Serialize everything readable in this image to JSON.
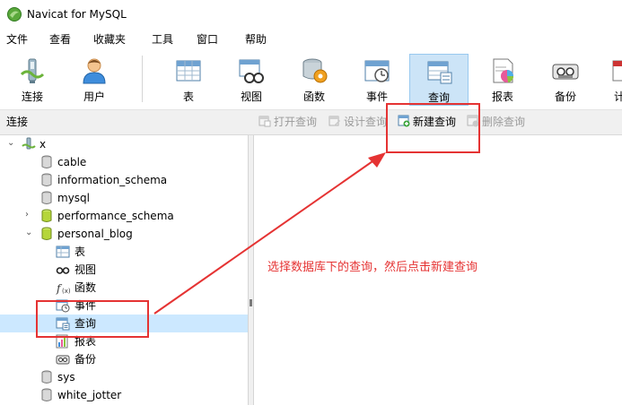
{
  "window": {
    "title": "Navicat for MySQL"
  },
  "menu": [
    "文件",
    "查看",
    "收藏夹",
    "工具",
    "窗口",
    "帮助"
  ],
  "toolbar": [
    {
      "label": "连接",
      "icon": "connection-icon"
    },
    {
      "label": "用户",
      "icon": "user-icon"
    },
    {
      "label": "表",
      "icon": "table-icon"
    },
    {
      "label": "视图",
      "icon": "view-icon"
    },
    {
      "label": "函数",
      "icon": "function-icon"
    },
    {
      "label": "事件",
      "icon": "event-icon"
    },
    {
      "label": "查询",
      "icon": "query-icon",
      "active": true
    },
    {
      "label": "报表",
      "icon": "report-icon"
    },
    {
      "label": "备份",
      "icon": "backup-icon"
    },
    {
      "label": "计",
      "icon": "schedule-icon"
    }
  ],
  "subheader": {
    "connection_label": "连接",
    "actions": [
      {
        "label": "打开查询",
        "enabled": false
      },
      {
        "label": "设计查询",
        "enabled": false
      },
      {
        "label": "新建查询",
        "enabled": true
      },
      {
        "label": "删除查询",
        "enabled": false
      }
    ]
  },
  "tree": [
    {
      "label": "x",
      "type": "connection",
      "expanded": true
    },
    {
      "label": "cable",
      "type": "database"
    },
    {
      "label": "information_schema",
      "type": "database"
    },
    {
      "label": "mysql",
      "type": "database"
    },
    {
      "label": "performance_schema",
      "type": "database-open",
      "collapsed": true
    },
    {
      "label": "personal_blog",
      "type": "database-open",
      "expanded": true
    },
    {
      "label": "表",
      "type": "tables"
    },
    {
      "label": "视图",
      "type": "views"
    },
    {
      "label": "函数",
      "type": "functions"
    },
    {
      "label": "事件",
      "type": "events"
    },
    {
      "label": "查询",
      "type": "queries",
      "selected": true
    },
    {
      "label": "报表",
      "type": "reports"
    },
    {
      "label": "备份",
      "type": "backups"
    },
    {
      "label": "sys",
      "type": "database"
    },
    {
      "label": "white_jotter",
      "type": "database"
    }
  ],
  "annotation": {
    "text": "选择数据库下的查询，然后点击新建查询",
    "color": "#e53333"
  },
  "colors": {
    "selection": "#cce8ff",
    "active_tool": "#cce4f7",
    "annotation_red": "#e53333"
  }
}
